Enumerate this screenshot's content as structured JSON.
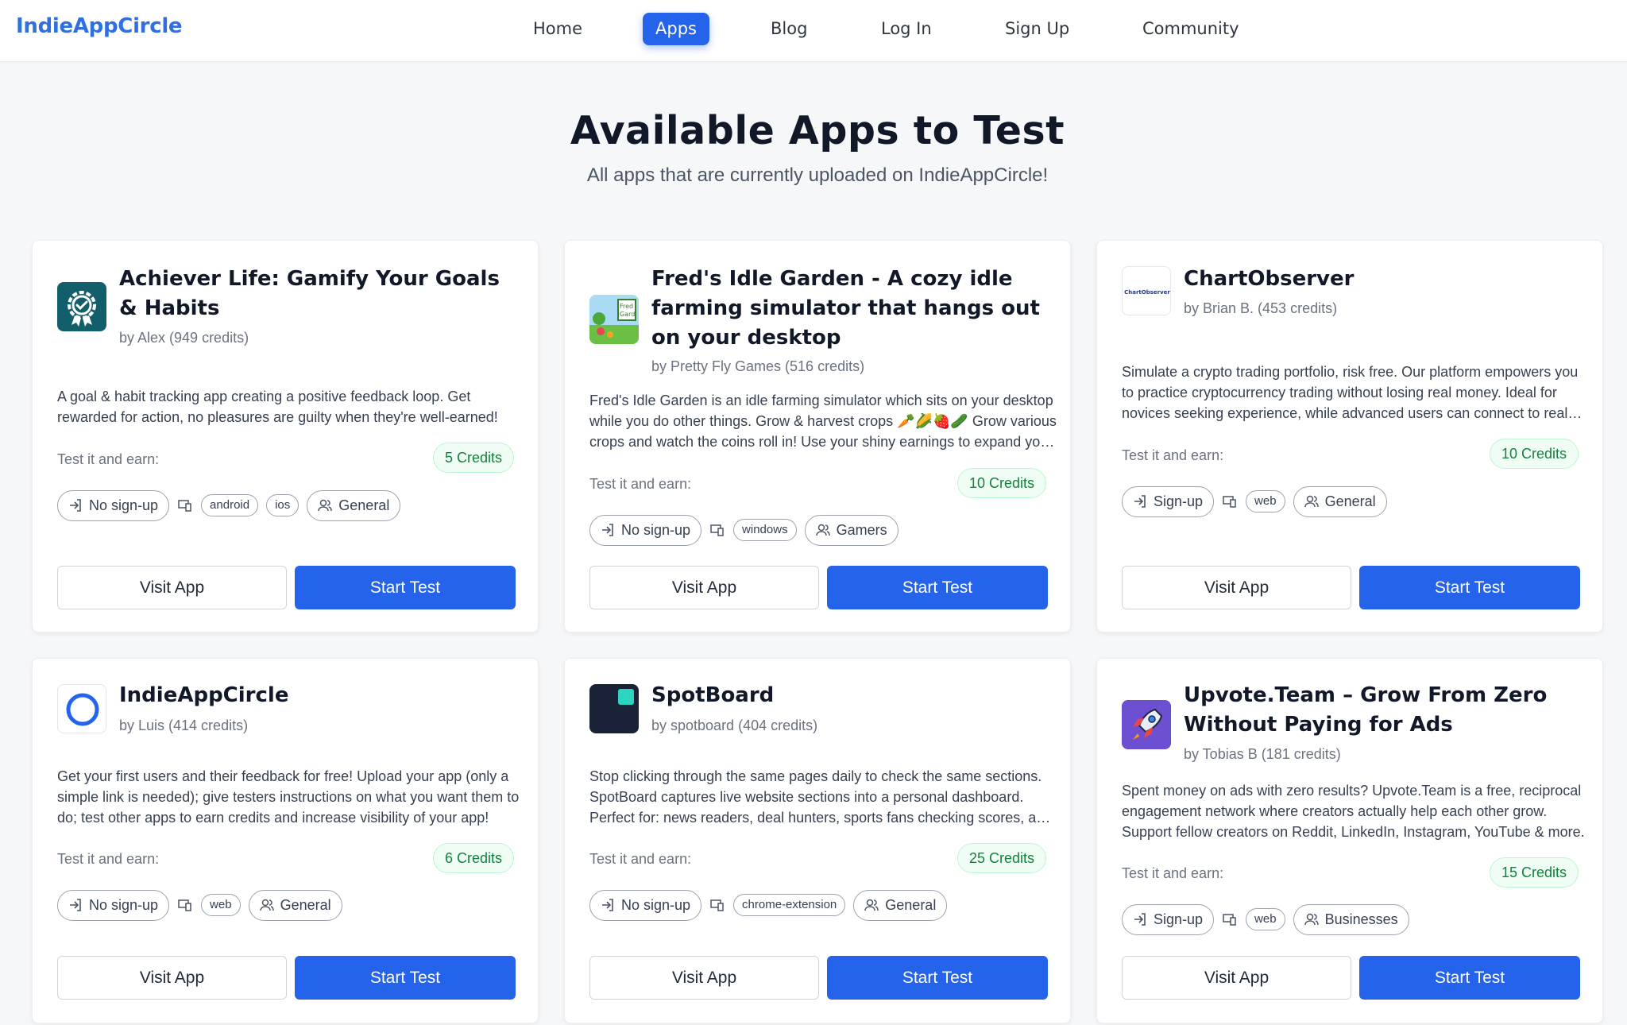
{
  "nav": {
    "brand": "IndieAppCircle",
    "links": [
      "Home",
      "Apps",
      "Blog",
      "Log In",
      "Sign Up",
      "Community"
    ],
    "active": "Apps"
  },
  "hero": {
    "title": "Available Apps to Test",
    "subtitle": "All apps that are currently uploaded on IndieAppCircle!"
  },
  "common": {
    "earn_label": "Test it and earn:",
    "visit_label": "Visit App",
    "start_label": "Start Test"
  },
  "apps": [
    {
      "title": "Achiever Life: Gamify Your Goals & Habits",
      "author": "by Alex (949 credits)",
      "description": "A goal & habit tracking app creating a positive feedback loop. Get rewarded for action, no pleasures are guilty when they're well-earned!",
      "credits": "5 Credits",
      "signup": "No sign-up",
      "platforms": [
        "android",
        "ios"
      ],
      "audience": "General",
      "logo": "achiever-life-logo"
    },
    {
      "title": "Fred's Idle Garden - A cozy idle farming simulator that hangs out on your desktop",
      "author": "by Pretty Fly Games (516 credits)",
      "description": "Fred's Idle Garden is an idle farming simulator which sits on your desktop while you do other things. Grow & harvest crops 🥕🌽🍓🥒 Grow various crops and watch the coins roll in! Use your shiny earnings to expand your garden and unlock new crops.",
      "credits": "10 Credits",
      "signup": "No sign-up",
      "platforms": [
        "windows"
      ],
      "audience": "Gamers",
      "logo": "freds-idle-garden-logo"
    },
    {
      "title": "ChartObserver",
      "author": "by Brian B. (453 credits)",
      "description": "Simulate a crypto trading portfolio, risk free. Our platform empowers you to practice cryptocurrency trading without losing real money. Ideal for novices seeking experience, while advanced users can connect to real exchanges.",
      "credits": "10 Credits",
      "signup": "Sign-up",
      "platforms": [
        "web"
      ],
      "audience": "General",
      "logo": "chartobserver-logo",
      "logo_text": "ChartObserver"
    },
    {
      "title": "IndieAppCircle",
      "author": "by Luis (414 credits)",
      "description": "Get your first users and their feedback for free! Upload your app (only a simple link is needed); give testers instructions on what you want them to do; test other apps to earn credits and increase visibility of your app!",
      "credits": "6 Credits",
      "signup": "No sign-up",
      "platforms": [
        "web"
      ],
      "audience": "General",
      "logo": "indieappcircle-logo"
    },
    {
      "title": "SpotBoard",
      "author": "by spotboard (404 credits)",
      "description": "Stop clicking through the same pages daily to check the same sections. SpotBoard captures live website sections into a personal dashboard. Perfect for: news readers, deal hunters, sports fans checking scores, and more.",
      "credits": "25 Credits",
      "signup": "No sign-up",
      "platforms": [
        "chrome-extension"
      ],
      "audience": "General",
      "logo": "spotboard-logo"
    },
    {
      "title": "Upvote.Team – Grow From Zero Without Paying for Ads",
      "author": "by Tobias B (181 credits)",
      "description": "Spent money on ads with zero results? Upvote.Team is a free, reciprocal engagement network where creators actually help each other grow. Support fellow creators on Reddit, LinkedIn, Instagram, YouTube & more.",
      "credits": "15 Credits",
      "signup": "Sign-up",
      "platforms": [
        "web"
      ],
      "audience": "Businesses",
      "logo": "upvote-team-logo"
    }
  ]
}
